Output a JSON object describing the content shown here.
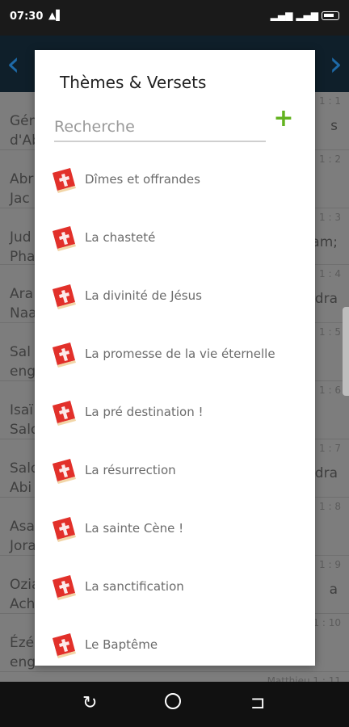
{
  "status_bar": {
    "time": "07:30",
    "left_icon": "signal-icon",
    "right_icons": [
      "cell-signal-icon",
      "cell-signal-icon",
      "battery-icon"
    ]
  },
  "app_bar": {
    "left_icon": "chevron-left-icon",
    "right_icon": "chevron-right-icon"
  },
  "background_list": [
    {
      "line1": "Gén",
      "line2": "d'Ab",
      "ref": "1 : 1",
      "side": "s"
    },
    {
      "line1": "Abr",
      "line2": "Jac",
      "ref": "1 : 2",
      "side": ""
    },
    {
      "line1": "Jud",
      "line2": "Pha",
      "ref": "1 : 3",
      "side": "am;"
    },
    {
      "line1": "Ara",
      "line2": "Naa",
      "ref": "1 : 4",
      "side": "dra"
    },
    {
      "line1": "Sal",
      "line2": "eng",
      "ref": "1 : 5",
      "side": ""
    },
    {
      "line1": "Isaï",
      "line2": "Salo",
      "ref": "1 : 6",
      "side": ""
    },
    {
      "line1": "Salo",
      "line2": "Abi",
      "ref": "1 : 7",
      "side": "dra"
    },
    {
      "line1": "Asa",
      "line2": "Jora",
      "ref": "1 : 8",
      "side": ""
    },
    {
      "line1": "Ozia",
      "line2": "Ach",
      "ref": "1 : 9",
      "side": "a"
    },
    {
      "line1": "Ézé",
      "line2": "eng",
      "ref": "1 : 10",
      "side": ""
    },
    {
      "line1": "",
      "line2": "",
      "ref": "Matthieu 1 : 11",
      "side": ""
    }
  ],
  "dialog": {
    "title": "Thèmes & Versets",
    "search": {
      "placeholder": "Recherche",
      "value": ""
    },
    "add_icon": "plus-icon",
    "item_icon": "book-icon",
    "items": [
      {
        "label": "Dîmes et offrandes"
      },
      {
        "label": "La chasteté"
      },
      {
        "label": "La divinité de Jésus"
      },
      {
        "label": "La promesse de la vie éternelle"
      },
      {
        "label": "La pré destination !"
      },
      {
        "label": "La résurrection"
      },
      {
        "label": "La sainte Cène !"
      },
      {
        "label": "La sanctification"
      },
      {
        "label": "Le Baptême"
      }
    ]
  },
  "nav_bar": {
    "icons": [
      "back-icon",
      "home-icon",
      "recents-icon"
    ]
  },
  "colors": {
    "accent": "#63b320",
    "status_bar": "#1a1a1a",
    "app_bar": "#0f1f2a",
    "nav_arrow": "#1e6aa8",
    "book_red": "#e2302a"
  }
}
